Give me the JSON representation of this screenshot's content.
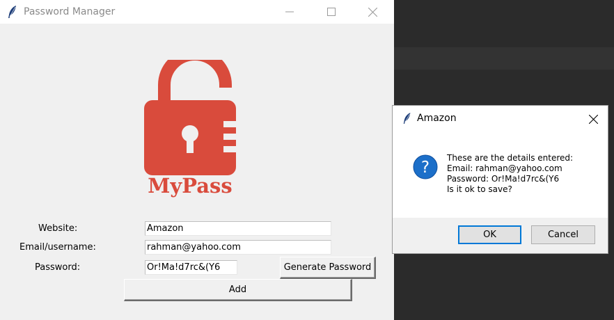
{
  "main_window": {
    "title": "Password Manager",
    "logo_text": "MyPass",
    "labels": {
      "website": "Website:",
      "email": "Email/username:",
      "password": "Password:"
    },
    "fields": {
      "website": "Amazon",
      "email": "rahman@yahoo.com",
      "password": "Or!Ma!d7rc&(Y6"
    },
    "buttons": {
      "generate": "Generate Password",
      "add": "Add"
    }
  },
  "dialog": {
    "title": "Amazon",
    "message_lines": [
      "These are the details entered:",
      "Email: rahman@yahoo.com",
      "Password: Or!Ma!d7rc&(Y6",
      "Is it ok to save?"
    ],
    "buttons": {
      "ok": "OK",
      "cancel": "Cancel"
    }
  },
  "colors": {
    "logo_red": "#d94b3c",
    "dialog_accent": "#0078d7",
    "question_icon": "#1c6fc9"
  },
  "icons": {
    "window": "feather-icon",
    "dialog_window": "feather-icon",
    "dialog_type": "question-icon"
  }
}
